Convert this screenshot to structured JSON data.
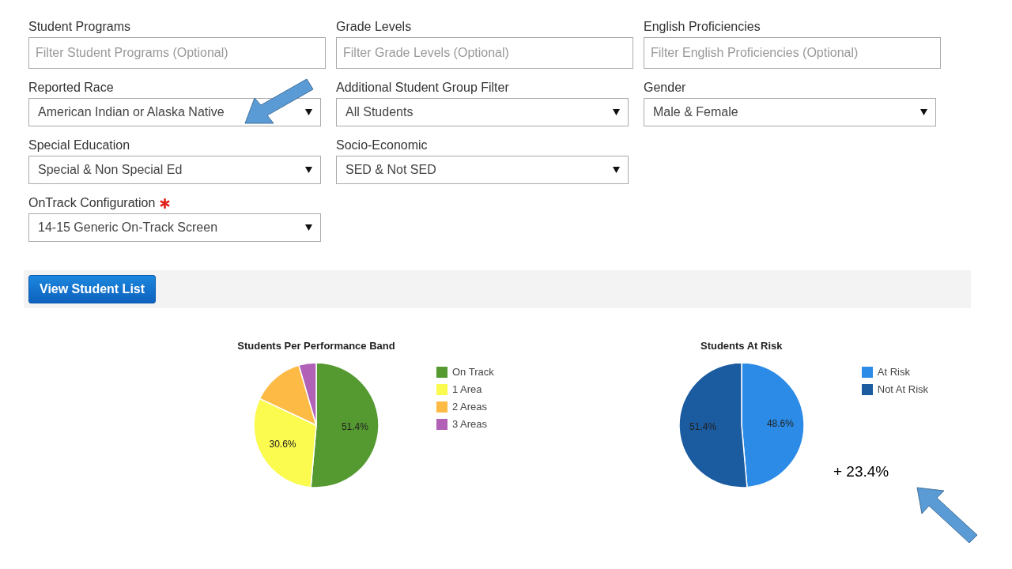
{
  "filters": [
    {
      "kind": "text",
      "label": "Student Programs",
      "placeholder": "Filter Student Programs (Optional)"
    },
    {
      "kind": "text",
      "label": "Grade Levels",
      "placeholder": "Filter Grade Levels (Optional)"
    },
    {
      "kind": "text",
      "label": "English Proficiencies",
      "placeholder": "Filter English Proficiencies (Optional)"
    },
    {
      "kind": "select",
      "label": "Reported Race",
      "value": "American Indian or Alaska Native"
    },
    {
      "kind": "select",
      "label": "Additional Student Group Filter",
      "value": "All Students"
    },
    {
      "kind": "select",
      "label": "Gender",
      "value": "Male & Female"
    },
    {
      "kind": "select",
      "label": "Special Education",
      "value": "Special & Non Special Ed"
    },
    {
      "kind": "select",
      "label": "Socio-Economic",
      "value": "SED & Not SED"
    },
    {
      "kind": "break"
    },
    {
      "kind": "select",
      "label": "OnTrack Configuration",
      "value": "14-15 Generic On-Track Screen",
      "required": true
    }
  ],
  "button": "View Student List",
  "charts": [
    {
      "chart_data": {
        "type": "pie",
        "title": "Students Per Performance Band",
        "categories": [
          "On Track",
          "1 Area",
          "2 Areas",
          "3 Areas"
        ],
        "values": [
          51.4,
          30.6,
          13.5,
          4.5
        ],
        "legend": "right",
        "colors": [
          "#559a31",
          "#fafa4f",
          "#fdba45",
          "#b162b7"
        ],
        "value_labels": [
          "51.4%",
          "30.6%",
          null,
          null
        ]
      }
    },
    {
      "chart_data": {
        "type": "pie",
        "title": "Students At Risk",
        "categories": [
          "At Risk",
          "Not At Risk"
        ],
        "values": [
          48.6,
          51.4
        ],
        "legend": "right",
        "colors": [
          "#2b8be6",
          "#1b5ba0"
        ],
        "value_labels": [
          "48.6%",
          "51.4%"
        ]
      }
    }
  ],
  "note": "+ 23.4%"
}
